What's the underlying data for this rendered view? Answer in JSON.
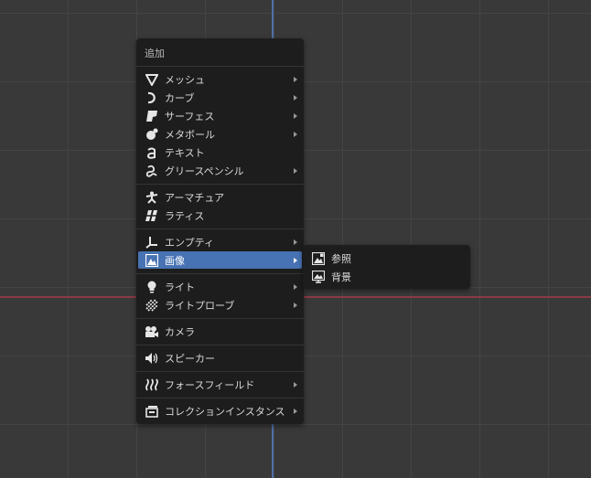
{
  "menu": {
    "title": "追加",
    "items": [
      {
        "label": "メッシュ",
        "icon": "mesh-icon",
        "submenu": true
      },
      {
        "label": "カーブ",
        "icon": "curve-icon",
        "submenu": true
      },
      {
        "label": "サーフェス",
        "icon": "surface-icon",
        "submenu": true
      },
      {
        "label": "メタボール",
        "icon": "metaball-icon",
        "submenu": true
      },
      {
        "label": "テキスト",
        "icon": "text-icon",
        "submenu": false
      },
      {
        "label": "グリースペンシル",
        "icon": "grease-pencil-icon",
        "submenu": true
      },
      {
        "label": "アーマチュア",
        "icon": "armature-icon",
        "submenu": false
      },
      {
        "label": "ラティス",
        "icon": "lattice-icon",
        "submenu": false
      },
      {
        "label": "エンプティ",
        "icon": "empty-icon",
        "submenu": true
      },
      {
        "label": "画像",
        "icon": "image-icon",
        "submenu": true,
        "active": true
      },
      {
        "label": "ライト",
        "icon": "light-icon",
        "submenu": true
      },
      {
        "label": "ライトプローブ",
        "icon": "light-probe-icon",
        "submenu": true
      },
      {
        "label": "カメラ",
        "icon": "camera-icon",
        "submenu": false
      },
      {
        "label": "スピーカー",
        "icon": "speaker-icon",
        "submenu": false
      },
      {
        "label": "フォースフィールド",
        "icon": "force-field-icon",
        "submenu": true
      },
      {
        "label": "コレクションインスタンス",
        "icon": "collection-instance-icon",
        "submenu": true
      }
    ]
  },
  "image_submenu": {
    "items": [
      {
        "label": "参照",
        "icon": "image-reference-icon"
      },
      {
        "label": "背景",
        "icon": "image-background-icon"
      }
    ]
  },
  "colors": {
    "background": "#393939",
    "menu": "#1d1d1d",
    "highlight": "#4772b3",
    "x_axis": "#8a3a44",
    "z_axis": "#4f6fa8"
  }
}
